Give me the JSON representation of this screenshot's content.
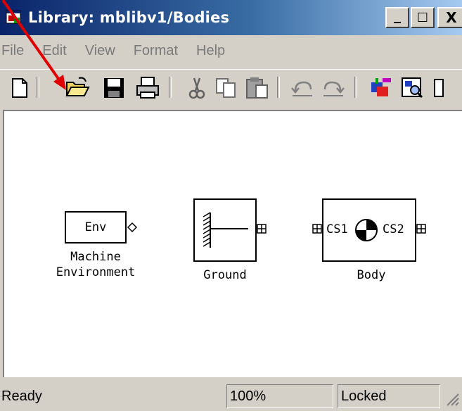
{
  "window": {
    "title": "Library: mblibv1/Bodies",
    "caption_buttons": [
      "_",
      "☐",
      "X"
    ]
  },
  "menu": {
    "items": [
      "File",
      "Edit",
      "View",
      "Format",
      "Help"
    ]
  },
  "toolbar": {
    "icons": [
      "new-document-icon",
      "open-folder-icon",
      "save-icon",
      "print-icon",
      "cut-icon",
      "copy-icon",
      "paste-icon",
      "undo-icon",
      "redo-icon",
      "library-browser-icon",
      "model-browser-icon"
    ]
  },
  "blocks": {
    "env": {
      "inner": "Env",
      "label_line1": "Machine",
      "label_line2": "Environment"
    },
    "ground": {
      "label": "Ground"
    },
    "body": {
      "port_left": "CS1",
      "port_right": "CS2",
      "label": "Body"
    }
  },
  "status": {
    "state": "Ready",
    "zoom": "100%",
    "lock": "Locked"
  },
  "colors": {
    "titlebar_start": "#0a246a",
    "titlebar_end": "#a6caf0",
    "annotation_arrow": "#e00000",
    "window_face": "#d4d0c8",
    "canvas": "#ffffff"
  }
}
